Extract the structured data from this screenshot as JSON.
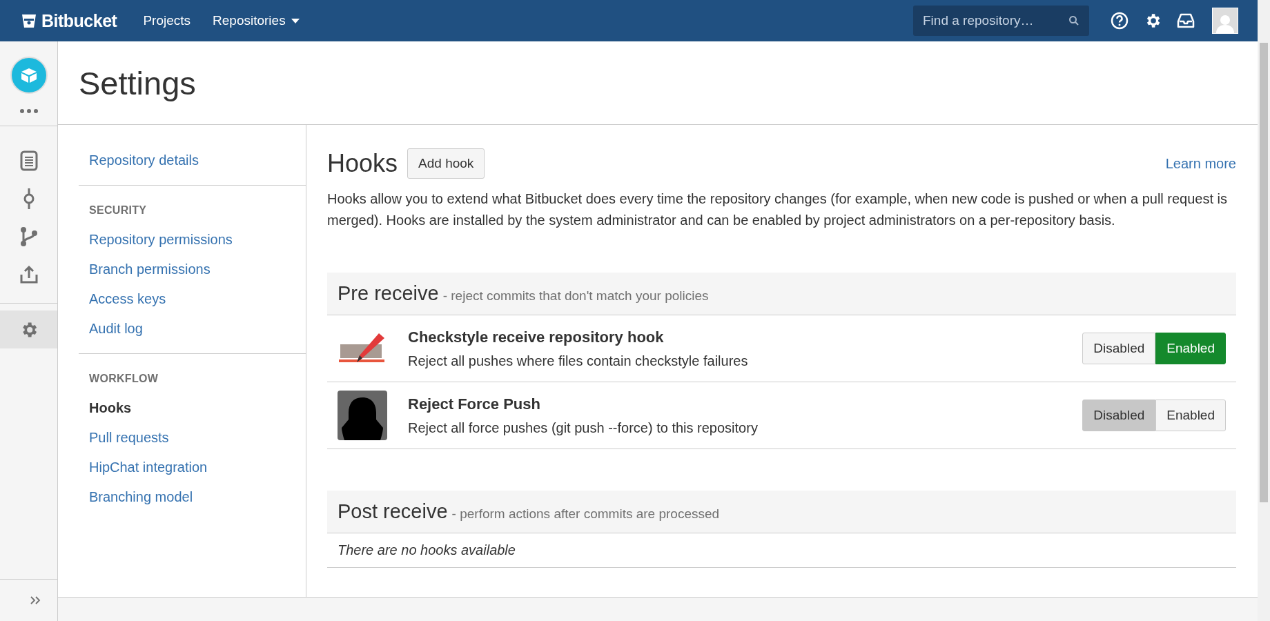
{
  "topbar": {
    "brand": "Bitbucket",
    "nav": [
      {
        "label": "Projects",
        "dropdown": false
      },
      {
        "label": "Repositories",
        "dropdown": true
      }
    ],
    "search": {
      "placeholder": "Find a repository…"
    }
  },
  "rail": {
    "items": [
      {
        "kind": "document",
        "selected": false
      },
      {
        "kind": "commit",
        "selected": false
      },
      {
        "kind": "branch",
        "selected": false
      },
      {
        "kind": "upload",
        "selected": false
      },
      {
        "kind": "settings",
        "selected": true
      }
    ]
  },
  "page": {
    "title": "Settings"
  },
  "settings_nav": {
    "groups": [
      {
        "items": [
          {
            "label": "Repository details",
            "selected": false
          }
        ]
      },
      {
        "heading": "SECURITY",
        "items": [
          {
            "label": "Repository permissions",
            "selected": false
          },
          {
            "label": "Branch permissions",
            "selected": false
          },
          {
            "label": "Access keys",
            "selected": false
          },
          {
            "label": "Audit log",
            "selected": false
          }
        ]
      },
      {
        "heading": "WORKFLOW",
        "items": [
          {
            "label": "Hooks",
            "selected": true
          },
          {
            "label": "Pull requests",
            "selected": false
          },
          {
            "label": "HipChat integration",
            "selected": false
          },
          {
            "label": "Branching model",
            "selected": false
          }
        ]
      }
    ]
  },
  "hooks": {
    "title": "Hooks",
    "add_button": "Add hook",
    "learn_more": "Learn more",
    "description": "Hooks allow you to extend what Bitbucket does every time the repository changes (for example, when new code is pushed or when a pull request is merged). Hooks are installed by the system administrator and can be enabled by project administrators on a per-repository basis.",
    "sections": [
      {
        "title": "Pre receive",
        "subtitle": "- reject commits that don't match your policies",
        "items": [
          {
            "kind": "marker",
            "name": "Checkstyle receive repository hook",
            "description": "Reject all pushes where files contain checkstyle failures",
            "options": [
              {
                "label": "Disabled",
                "selected": false
              },
              {
                "label": "Enabled",
                "selected": true
              }
            ]
          },
          {
            "kind": "silhouette",
            "name": "Reject Force Push",
            "description": "Reject all force pushes (git push --force) to this repository",
            "options": [
              {
                "label": "Disabled",
                "selected": true
              },
              {
                "label": "Enabled",
                "selected": false
              }
            ]
          }
        ]
      },
      {
        "title": "Post receive",
        "subtitle": "- perform actions after commits are processed",
        "empty_message": "There are no hooks available"
      }
    ]
  }
}
